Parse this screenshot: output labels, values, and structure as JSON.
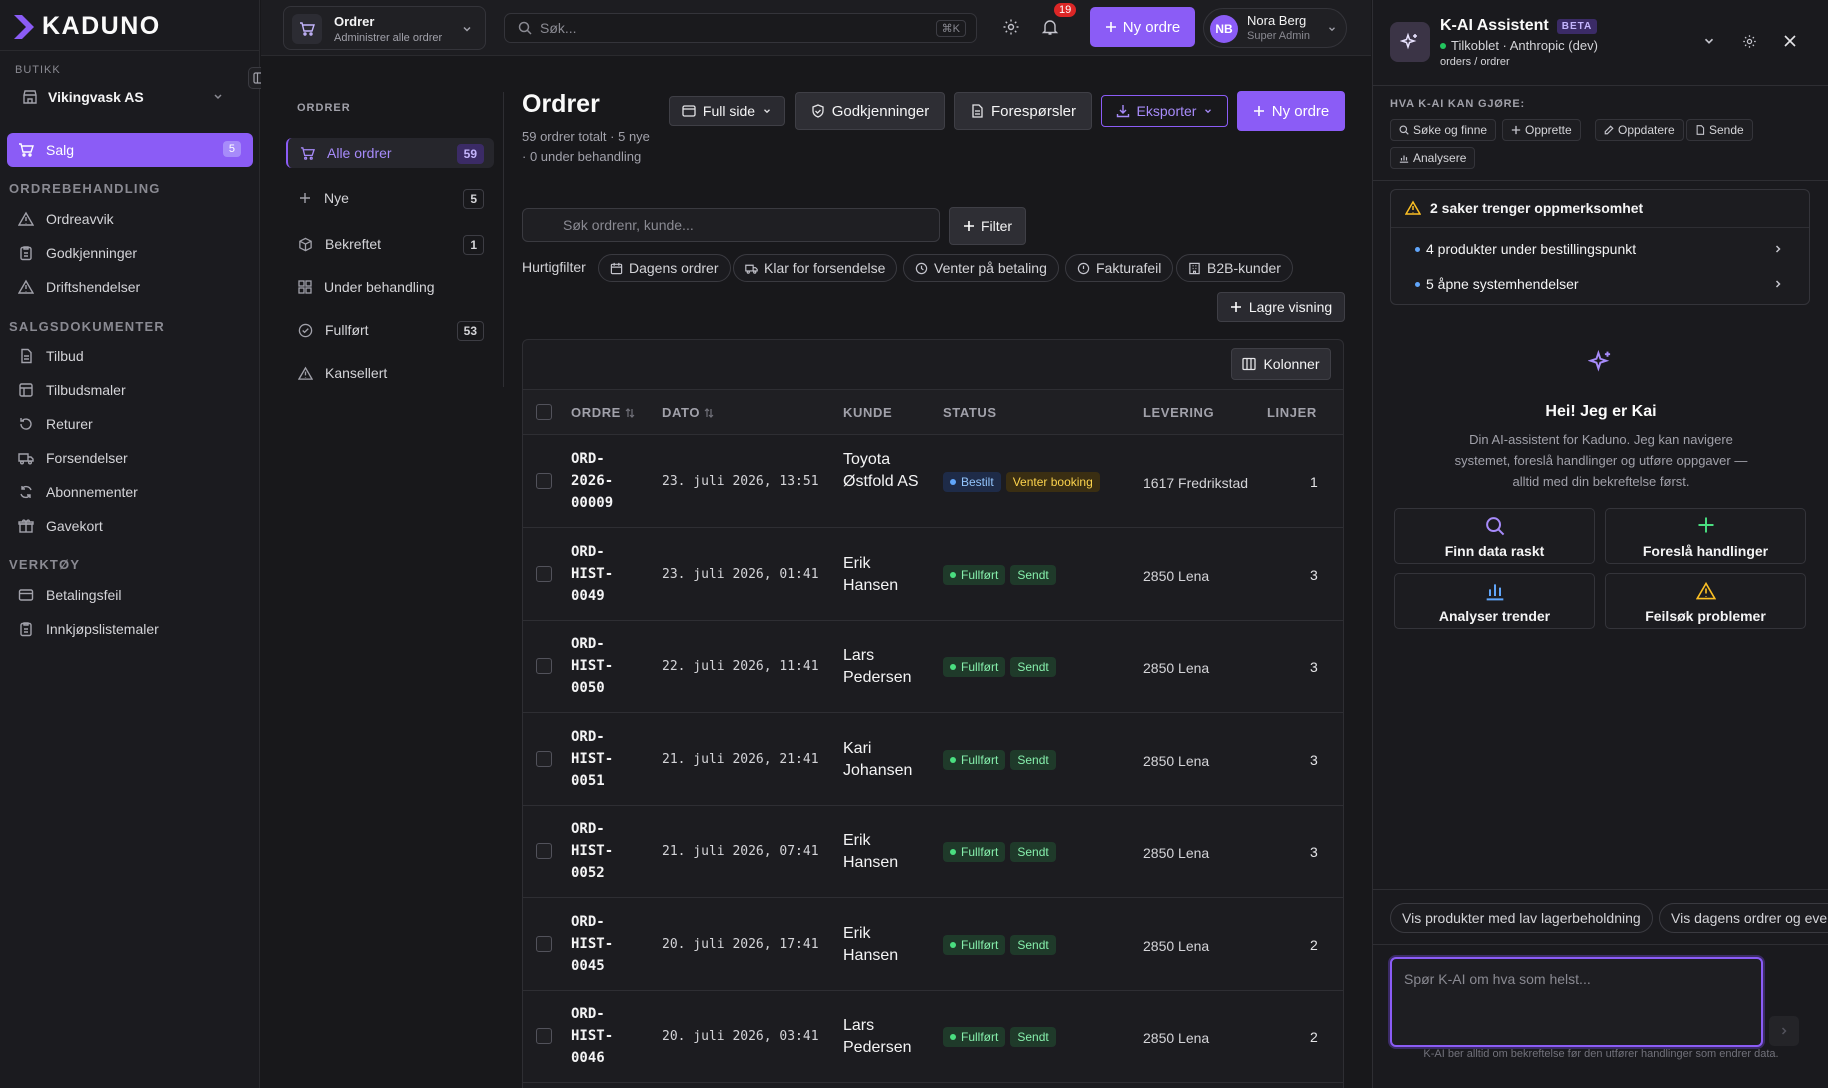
{
  "brand": {
    "logo_text": "KADUNO",
    "accent": "#8b5cf6"
  },
  "sidebar": {
    "store_label": "BUTIKK",
    "store_name": "Vikingvask AS",
    "active": {
      "label": "Salg",
      "count": "5"
    },
    "sections": [
      {
        "title": "ORDREBEHANDLING",
        "items": [
          "Ordreavvik",
          "Godkjenninger",
          "Driftshendelser"
        ]
      },
      {
        "title": "SALGSDOKUMENTER",
        "items": [
          "Tilbud",
          "Tilbudsmaler",
          "Returer",
          "Forsendelser",
          "Abonnementer",
          "Gavekort"
        ]
      },
      {
        "title": "VERKTØY",
        "items": [
          "Betalingsfeil",
          "Innkjøpslistemaler"
        ]
      }
    ]
  },
  "topbar": {
    "module_title": "Ordrer",
    "module_subtitle": "Administrer alle ordrer",
    "search_placeholder": "Søk...",
    "search_shortcut": "⌘K",
    "notification_count": "19",
    "new_order_label": "Ny ordre",
    "user": {
      "initials": "NB",
      "name": "Nora Berg",
      "role": "Super Admin"
    }
  },
  "order_nav": {
    "title": "ORDRER",
    "items": [
      {
        "label": "Alle ordrer",
        "count": "59",
        "icon": "cart-icon"
      },
      {
        "label": "Nye",
        "count": "5",
        "icon": "plus-icon"
      },
      {
        "label": "Bekreftet",
        "count": "1",
        "icon": "package-icon"
      },
      {
        "label": "Under behandling",
        "count": "",
        "icon": "grid-icon"
      },
      {
        "label": "Fullført",
        "count": "53",
        "icon": "check-circle-icon"
      },
      {
        "label": "Kansellert",
        "count": "",
        "icon": "warning-icon"
      }
    ]
  },
  "main": {
    "title": "Ordrer",
    "subtitle": "59 ordrer totalt · 5 nye · 0 under behandling",
    "buttons": {
      "full_page": "Full side",
      "approvals": "Godkjenninger",
      "requests": "Forespørsler",
      "export": "Eksporter",
      "new_order": "Ny ordre"
    },
    "search_placeholder": "Søk ordrenr, kunde...",
    "filter_label": "Filter",
    "quick_filter_label": "Hurtigfilter",
    "quick_filters": [
      "Dagens ordrer",
      "Klar for forsendelse",
      "Venter på betaling",
      "Fakturafeil",
      "B2B-kunder"
    ],
    "save_view_label": "Lagre visning",
    "columns_label": "Kolonner",
    "table": {
      "headers": [
        "ORDRE",
        "DATO",
        "KUNDE",
        "STATUS",
        "LEVERING",
        "LINJER"
      ],
      "rows": [
        {
          "order": "ORD-\n2026-\n00009",
          "date": "23. juli 2026, 13:51",
          "customer": "Toyota Østfold AS",
          "status": "Bestilt",
          "fulfillment": "Venter booking",
          "delivery": "1617 Fredrikstad",
          "lines": "1"
        },
        {
          "order": "ORD-\nHIST-\n0049",
          "date": "23. juli 2026, 01:41",
          "customer": "Erik Hansen",
          "status": "Fullført",
          "fulfillment": "Sendt",
          "delivery": "2850 Lena",
          "lines": "3"
        },
        {
          "order": "ORD-\nHIST-\n0050",
          "date": "22. juli 2026, 11:41",
          "customer": "Lars Pedersen",
          "status": "Fullført",
          "fulfillment": "Sendt",
          "delivery": "2850 Lena",
          "lines": "3"
        },
        {
          "order": "ORD-\nHIST-\n0051",
          "date": "21. juli 2026, 21:41",
          "customer": "Kari Johansen",
          "status": "Fullført",
          "fulfillment": "Sendt",
          "delivery": "2850 Lena",
          "lines": "3"
        },
        {
          "order": "ORD-\nHIST-\n0052",
          "date": "21. juli 2026, 07:41",
          "customer": "Erik Hansen",
          "status": "Fullført",
          "fulfillment": "Sendt",
          "delivery": "2850 Lena",
          "lines": "3"
        },
        {
          "order": "ORD-\nHIST-\n0045",
          "date": "20. juli 2026, 17:41",
          "customer": "Erik Hansen",
          "status": "Fullført",
          "fulfillment": "Sendt",
          "delivery": "2850 Lena",
          "lines": "2"
        },
        {
          "order": "ORD-\nHIST-\n0046",
          "date": "20. juli 2026, 03:41",
          "customer": "Lars Pedersen",
          "status": "Fullført",
          "fulfillment": "Sendt",
          "delivery": "2850 Lena",
          "lines": "2"
        }
      ]
    }
  },
  "ai_panel": {
    "title": "K-AI Assistent",
    "beta": "BETA",
    "status": "Tilkoblet · Anthropic (dev)",
    "path": "orders / ordrer",
    "capabilities_label": "HVA K-AI KAN GJØRE:",
    "capabilities": [
      "Søke og finne",
      "Opprette",
      "Oppdatere",
      "Sende",
      "Analysere"
    ],
    "attention_title": "2 saker trenger oppmerksomhet",
    "attention_items": [
      "4 produkter under bestillingspunkt",
      "5 åpne systemhendelser"
    ],
    "greeting": "Hei! Jeg er Kai",
    "description": "Din AI-assistent for Kaduno. Jeg kan navigere systemet, foreslå handlinger og utføre oppgaver — alltid med din bekreftelse først.",
    "actions": [
      "Finn data raskt",
      "Foreslå handlinger",
      "Analyser trender",
      "Feilsøk problemer"
    ],
    "suggestions": [
      "Vis produkter med lav lagerbeholdning",
      "Vis dagens ordrer og eventuelle avvik"
    ],
    "input_placeholder": "Spør K-AI om hva som helst...",
    "footer": "K-AI ber alltid om bekreftelse før den utfører handlinger som endrer data."
  }
}
